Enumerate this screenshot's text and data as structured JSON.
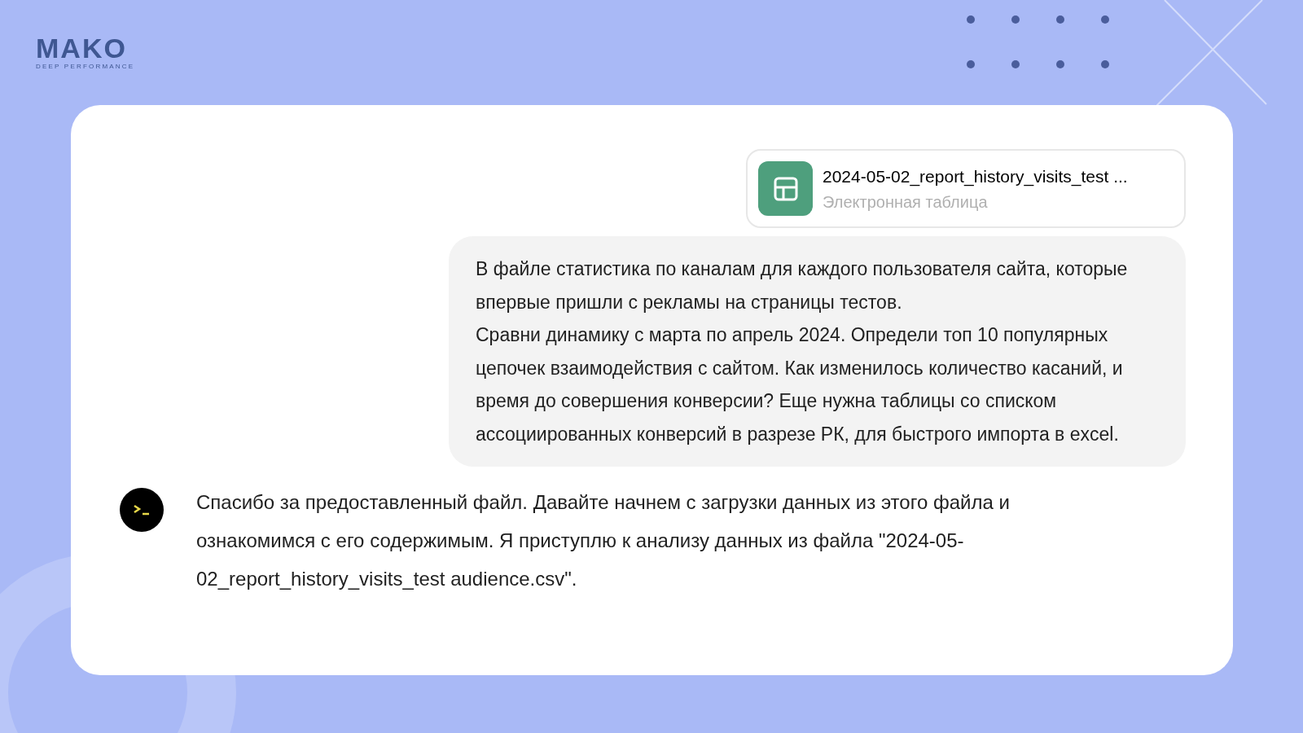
{
  "logo": {
    "name": "MAKO",
    "tagline": "DEEP PERFORMANCE"
  },
  "chat": {
    "attachment": {
      "file_name": "2024-05-02_report_history_visits_test ...",
      "file_type": "Электронная таблица"
    },
    "user_message": [
      "В файле статистика по каналам для каждого пользователя сайта, которые впервые пришли с рекламы на страницы тестов.",
      "Сравни динамику с марта по апрель 2024. Определи топ 10 популярных цепочек взаимодействия с сайтом. Как изменилось количество касаний, и время до совершения конверсии? Еще нужна таблицы со списком ассоциированных конверсий в разрезе РК, для быстрого импорта в excel."
    ],
    "assistant_message": "Спасибо за предоставленный файл. Давайте начнем с загрузки данных из этого файла и ознакомимся с его содержимым. Я приступлю к анализу данных из файла \"2024-05-02_report_history_visits_test audience.csv\"."
  }
}
